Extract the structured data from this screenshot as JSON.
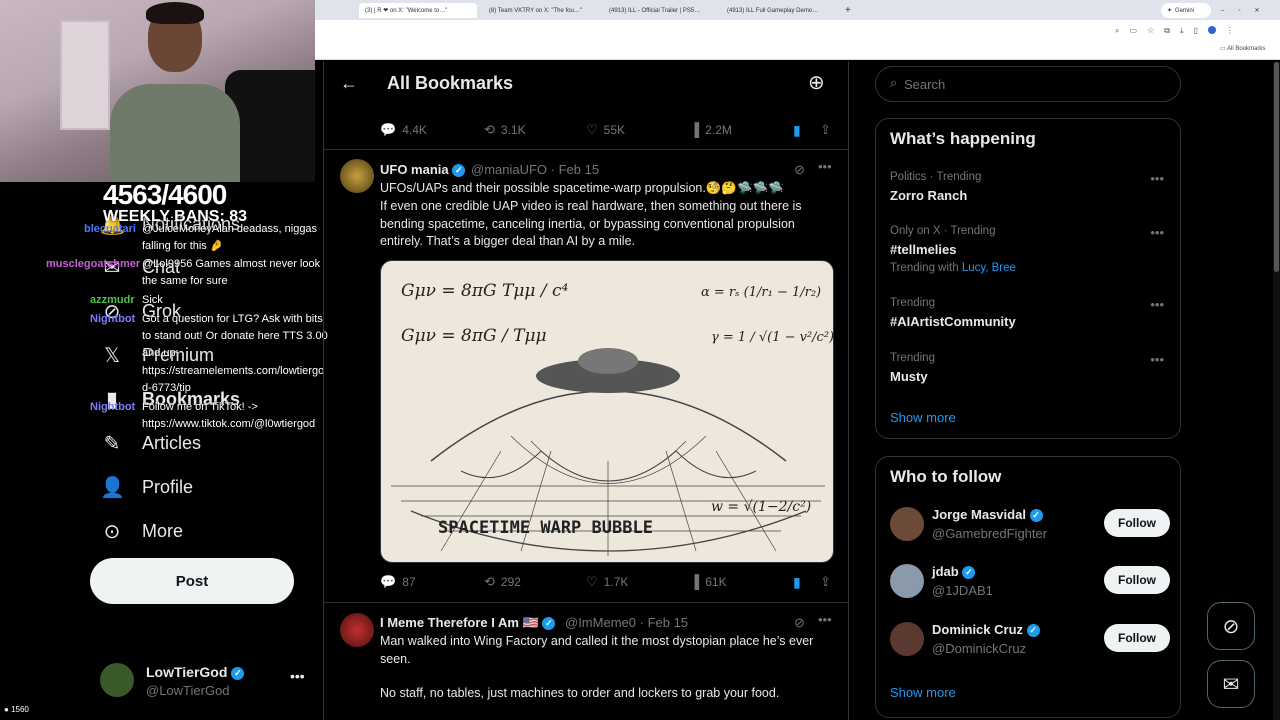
{
  "browser": {
    "tabs": [
      {
        "label": "(3) | R ❤ on X: \"Welcome to…\""
      },
      {
        "label": "(8) Team VKTRY on X: \"The fou…\""
      },
      {
        "label": "(4913) ILL - Official Trailer | PS5…"
      },
      {
        "label": "(4913) ILL Full Gameplay Demo…"
      }
    ],
    "gemini_label": "Gemini",
    "bookmarks_folder": "All Bookmarks"
  },
  "stream": {
    "score": "4563/4600",
    "weekly": "WEEKLY BANS: 83",
    "viewer_count": "1560",
    "chat": [
      {
        "name": "blecuatari",
        "text": "@JuiceMoneyAlan deadass, niggas",
        "color": "#4a7bff"
      },
      {
        "name": "",
        "text": "falling for this 🤌",
        "color": "#fff"
      },
      {
        "name": "musclegoatshmer",
        "text": "@Lol9956 Games almost never look",
        "color": "#c85fd8"
      },
      {
        "name": "",
        "text": "the same for sure",
        "color": "#fff"
      },
      {
        "name": "azzmudr",
        "text": "Sick",
        "color": "#4fbf4f"
      },
      {
        "name": "Nightbot",
        "text": "Got a question for LTG? Ask with bits",
        "color": "#7c7cff"
      },
      {
        "name": "",
        "text": "to stand out! Or donate here TTS 3.00",
        "color": "#fff"
      },
      {
        "name": "",
        "text": "and up:",
        "color": "#fff"
      },
      {
        "name": "",
        "text": "https://streamelements.com/lowtiergo",
        "color": "#fff"
      },
      {
        "name": "",
        "text": "d-6773/tip",
        "color": "#fff"
      },
      {
        "name": "Nightbot",
        "text": "Follow me on TikTok! ->",
        "color": "#7c7cff"
      },
      {
        "name": "",
        "text": "https://www.tiktok.com/@l0wtiergod",
        "color": "#fff"
      }
    ]
  },
  "nav": {
    "items": [
      {
        "label": "Notifications",
        "icon": "bell-icon"
      },
      {
        "label": "Chat",
        "icon": "mail-icon"
      },
      {
        "label": "Grok",
        "icon": "grok-icon"
      },
      {
        "label": "Premium",
        "icon": "x-icon"
      },
      {
        "label": "Bookmarks",
        "icon": "bookmark-icon"
      },
      {
        "label": "Articles",
        "icon": "article-icon"
      },
      {
        "label": "Profile",
        "icon": "person-icon"
      },
      {
        "label": "More",
        "icon": "more-icon"
      }
    ],
    "post_label": "Post",
    "account": {
      "name": "LowTierGod",
      "handle": "@LowTierGod"
    }
  },
  "header": {
    "title": "All Bookmarks"
  },
  "tweets": [
    {
      "replies": "4.4K",
      "reposts": "3.1K",
      "likes": "55K",
      "views": "2.2M"
    },
    {
      "name": "UFO mania",
      "handle": "@maniaUFO",
      "date": "· Feb 15",
      "text1": "UFOs/UAPs and their possible spacetime-warp propulsion.🧐🤔🛸🛸🛸",
      "text2": "If even one credible UAP video is real hardware, then something  out there is bending spacetime, canceling inertia, or bypassing  conventional propulsion entirely. That’s a bigger deal than AI by a  mile.",
      "image_caption": "SPACETIME WARP BUBBLE",
      "eq1": "Gμν = 8πG Tμμ / c⁴",
      "eq2": "Gμν = 8πG / Tμμ",
      "eq3": "α = rₛ (1/r₁ − 1/r₂)",
      "eq4": "γ = 1 / √(1 − v²/c²)",
      "eq5": "w = √(1−2/c²)",
      "replies": "87",
      "reposts": "292",
      "likes": "1.7K",
      "views": "61K"
    },
    {
      "name": "I Meme Therefore I Am 🇺🇸",
      "handle": "@ImMeme0",
      "date": "· Feb 15",
      "text1": "Man walked into Wing Factory and called it the most dystopian place he’s ever seen.",
      "text2": "No staff, no tables, just machines to order and lockers to grab your food."
    }
  ],
  "sidebar": {
    "search_placeholder": "Search",
    "happening_title": "What’s happening",
    "trends": [
      {
        "meta": "Politics · Trending",
        "topic": "Zorro Ranch",
        "with": ""
      },
      {
        "meta": "Only on X · Trending",
        "topic": "#tellmelies",
        "with_prefix": "Trending with",
        "with": "Lucy, Bree"
      },
      {
        "meta": "Trending",
        "topic": "#AIArtistCommunity",
        "with": ""
      },
      {
        "meta": "Trending",
        "topic": "Musty",
        "with": ""
      }
    ],
    "show_more": "Show more",
    "who_title": "Who to follow",
    "follows": [
      {
        "name": "Jorge Masvidal",
        "handle": "@GamebredFighter",
        "button": "Follow"
      },
      {
        "name": "jdab",
        "handle": "@1JDAB1",
        "button": "Follow"
      },
      {
        "name": "Dominick Cruz",
        "handle": "@DominickCruz",
        "button": "Follow"
      }
    ],
    "show_more_2": "Show more"
  },
  "colors": {
    "accent": "#1d9bf0",
    "background": "#000000",
    "border": "#2f3336",
    "muted": "#71767b"
  }
}
